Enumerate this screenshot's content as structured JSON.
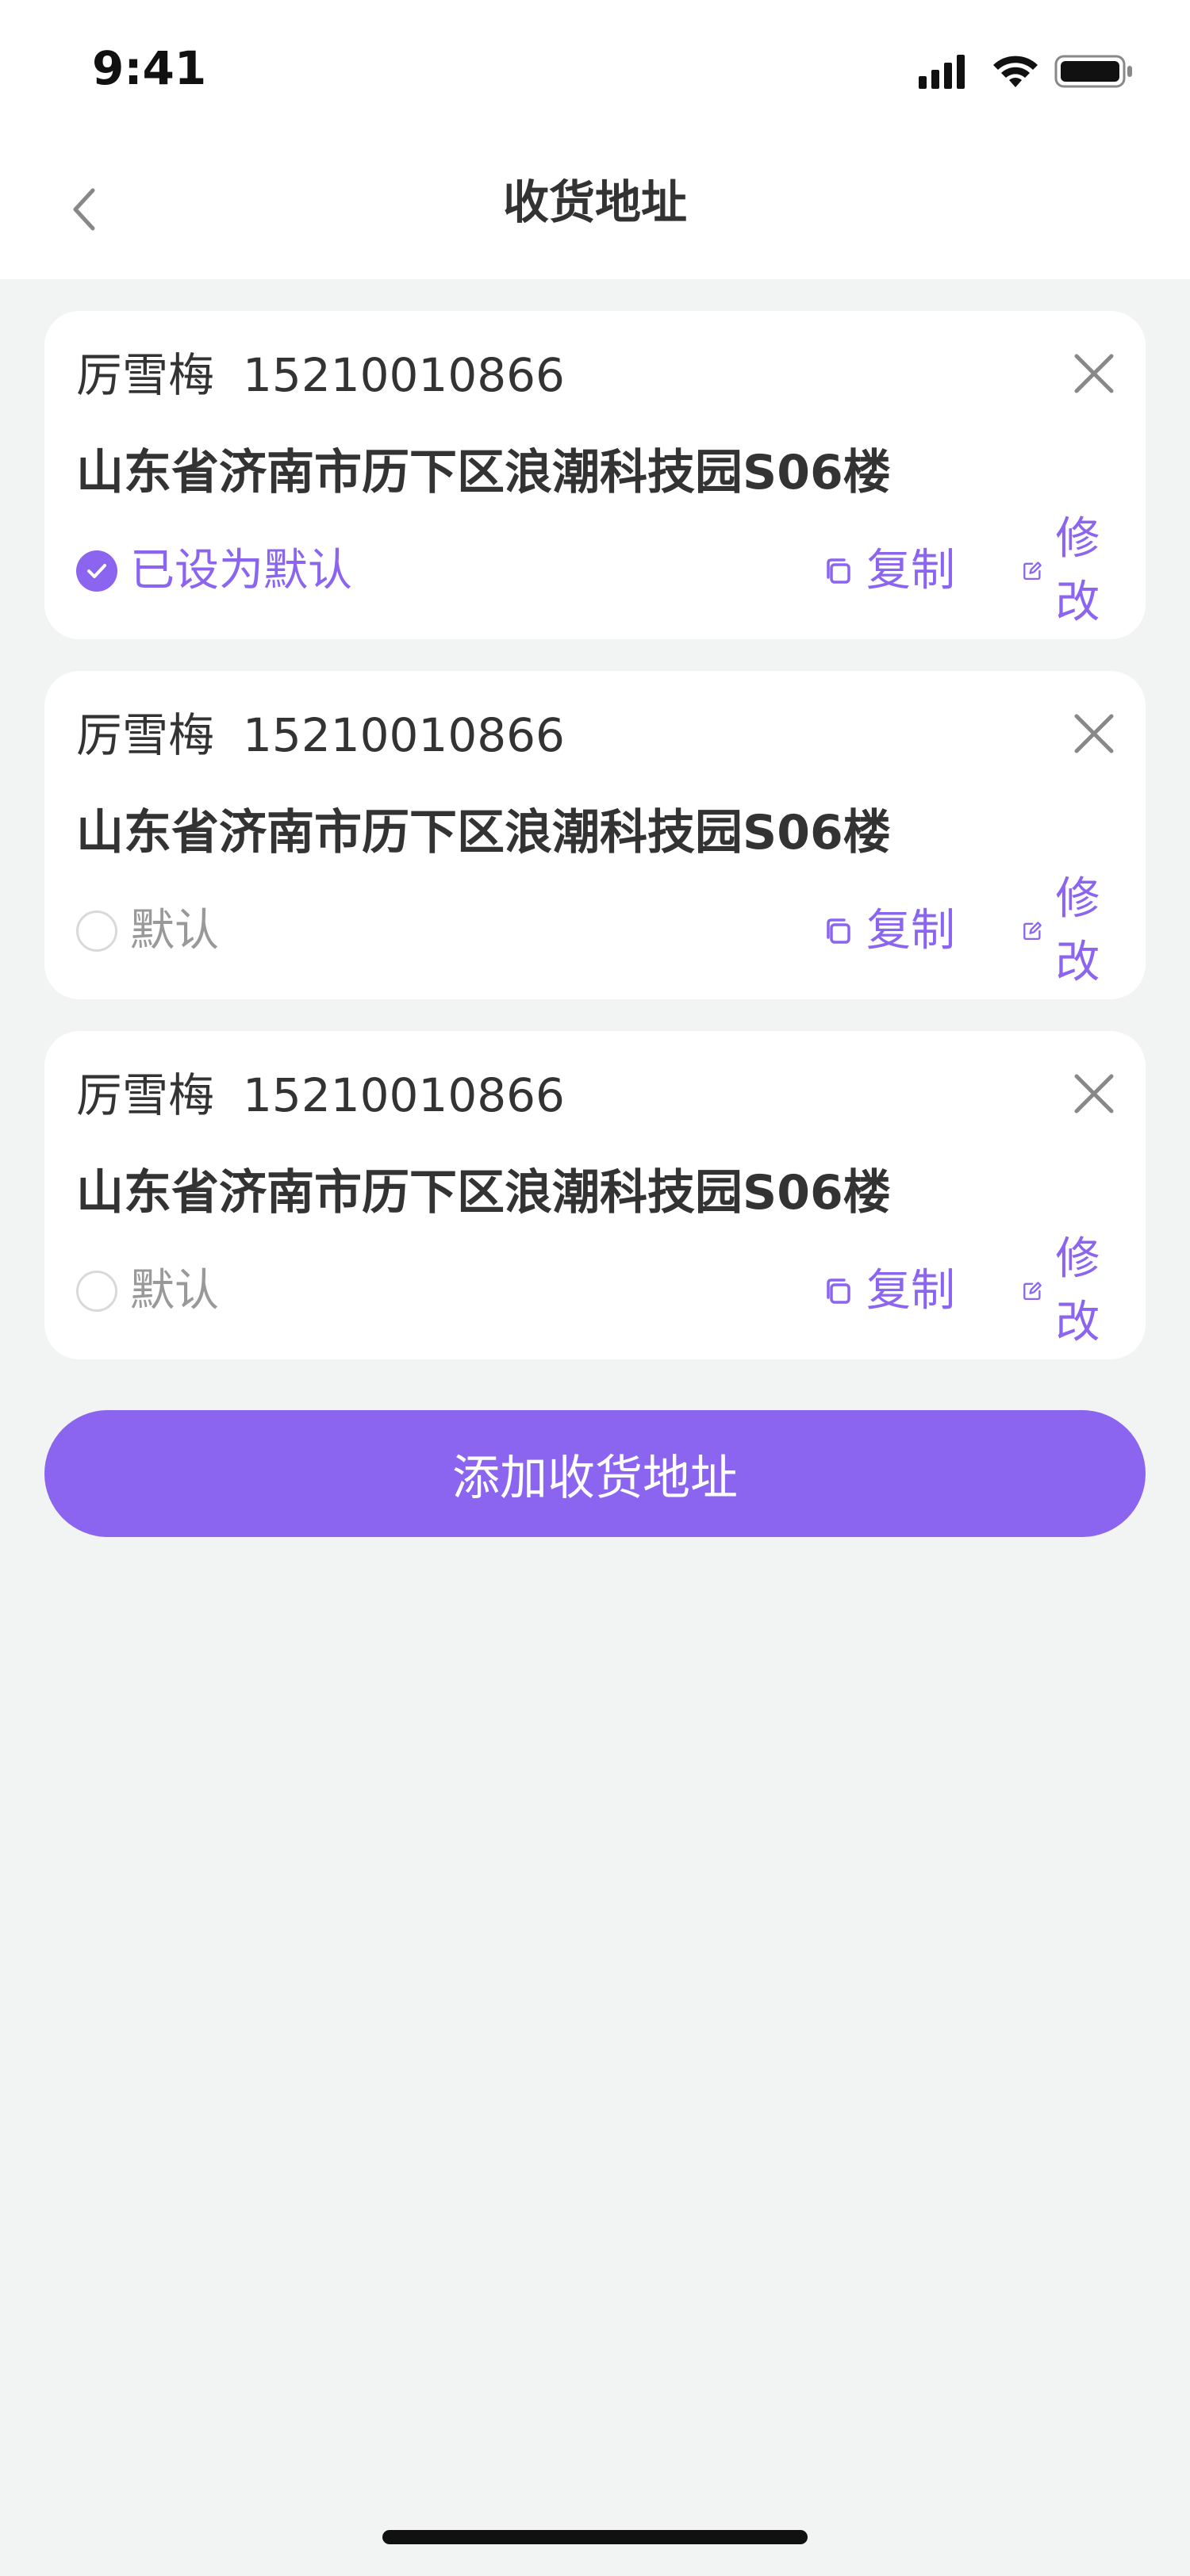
{
  "status_bar": {
    "time": "9:41"
  },
  "header": {
    "title": "收货地址",
    "back_icon": "chevron-left-icon"
  },
  "addresses": [
    {
      "name": "厉雪梅",
      "phone": "15210010866",
      "address": "山东省济南市历下区浪潮科技园S06楼",
      "is_default": true,
      "default_label": "已设为默认",
      "copy_label": "复制",
      "edit_label": "修改"
    },
    {
      "name": "厉雪梅",
      "phone": "15210010866",
      "address": "山东省济南市历下区浪潮科技园S06楼",
      "is_default": false,
      "default_label": "默认",
      "copy_label": "复制",
      "edit_label": "修改"
    },
    {
      "name": "厉雪梅",
      "phone": "15210010866",
      "address": "山东省济南市历下区浪潮科技园S06楼",
      "is_default": false,
      "default_label": "默认",
      "copy_label": "复制",
      "edit_label": "修改"
    }
  ],
  "add_button": {
    "label": "添加收货地址"
  },
  "colors": {
    "accent": "#8b64f0",
    "background": "#f2f3f3",
    "card": "#ffffff",
    "text": "#333333",
    "muted": "#999999"
  }
}
